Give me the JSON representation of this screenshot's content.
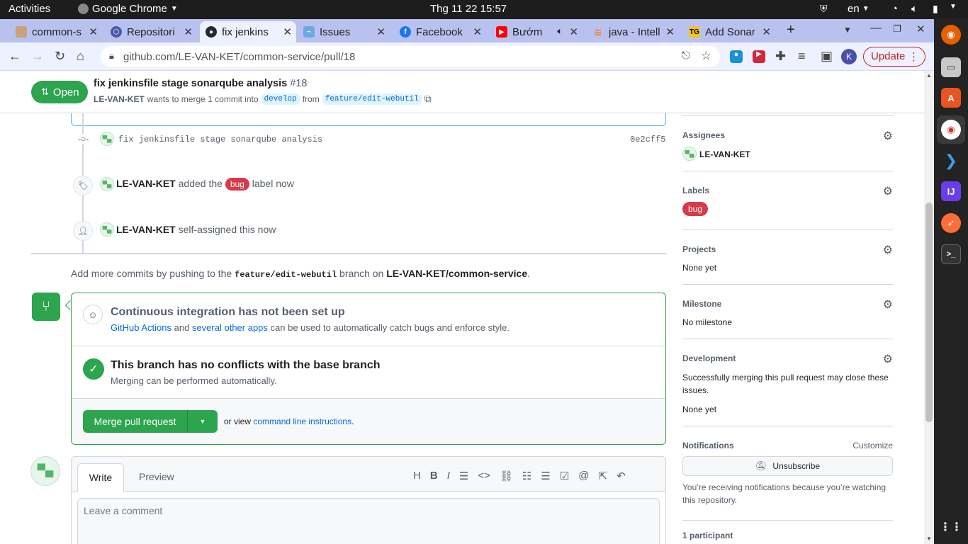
{
  "system_bar": {
    "activities": "Activities",
    "app_name": "Google Chrome",
    "clock": "Thg 11 22  15:57",
    "language": "en"
  },
  "tabs": [
    {
      "title": "common-s",
      "favicon": "user-avatar-icon",
      "active": false
    },
    {
      "title": "Repositori",
      "favicon": "sonarqube-icon",
      "active": false
    },
    {
      "title": "fix jenkins",
      "favicon": "github-icon",
      "active": true
    },
    {
      "title": "Issues",
      "favicon": "jira-icon",
      "active": false
    },
    {
      "title": "Facebook",
      "favicon": "facebook-icon",
      "active": false
    },
    {
      "title": "Bướm",
      "favicon": "youtube-icon",
      "active": false
    },
    {
      "title": "java - Intell",
      "favicon": "stackoverflow-icon",
      "active": false
    },
    {
      "title": "Add Sonar",
      "favicon": "tg-icon",
      "active": false
    }
  ],
  "toolbar": {
    "url": "github.com/LE-VAN-KET/common-service/pull/18",
    "profile_initial": "K",
    "update_label": "Update"
  },
  "pr_header": {
    "state_label": "Open",
    "title": "fix jenkinsfile stage sonarqube analysis",
    "number": "#18",
    "author": "LE-VAN-KET",
    "merge_text": "wants to merge 1 commit into",
    "base_branch": "develop",
    "from_text": "from",
    "head_branch": "feature/edit-webutil"
  },
  "timeline": {
    "commit_message": "fix jenkinsfile stage sonarqube analysis",
    "commit_sha": "0e2cff5",
    "label_event": {
      "actor": "LE-VAN-KET",
      "pre": "added the",
      "label": "bug",
      "post": "label now"
    },
    "assign_event": {
      "actor": "LE-VAN-KET",
      "text": "self-assigned this now"
    }
  },
  "push_hint": {
    "pre": "Add more commits by pushing to the",
    "branch": "feature/edit-webutil",
    "mid": "branch on",
    "repo": "LE-VAN-KET/common-service",
    "end": "."
  },
  "merge_box": {
    "ci_title": "Continuous integration has not been set up",
    "ci_link1": "GitHub Actions",
    "ci_and": "and",
    "ci_link2": "several other apps",
    "ci_rest": "can be used to automatically catch bugs and enforce style.",
    "conflict_title": "This branch has no conflicts with the base branch",
    "conflict_sub": "Merging can be performed automatically.",
    "merge_button": "Merge pull request",
    "or_view": "or view",
    "cli_link": "command line instructions",
    "cli_end": "."
  },
  "comment": {
    "tab_write": "Write",
    "tab_preview": "Preview",
    "placeholder": "Leave a comment",
    "toolbar_icons": [
      "heading-icon",
      "bold-icon",
      "italic-icon",
      "quote-icon",
      "code-icon",
      "link-icon",
      "bulleted-list-icon",
      "numbered-list-icon",
      "task-list-icon",
      "mention-icon",
      "reference-icon",
      "reply-icon"
    ]
  },
  "sidebar": {
    "assignees_h": "Assignees",
    "assignee": "LE-VAN-KET",
    "labels_h": "Labels",
    "label": "bug",
    "projects_h": "Projects",
    "projects_v": "None yet",
    "milestone_h": "Milestone",
    "milestone_v": "No milestone",
    "development_h": "Development",
    "development_v": "Successfully merging this pull request may close these issues.",
    "development_none": "None yet",
    "notifications_h": "Notifications",
    "customize": "Customize",
    "unsubscribe": "Unsubscribe",
    "notif_reason": "You’re receiving notifications because you’re watching this repository.",
    "participants": "1 participant"
  },
  "colors": {
    "accent_green": "#2da44e",
    "link_blue": "#0969da",
    "bug_label": "#d73a4a",
    "tab_strip": "#b9c2ef"
  }
}
